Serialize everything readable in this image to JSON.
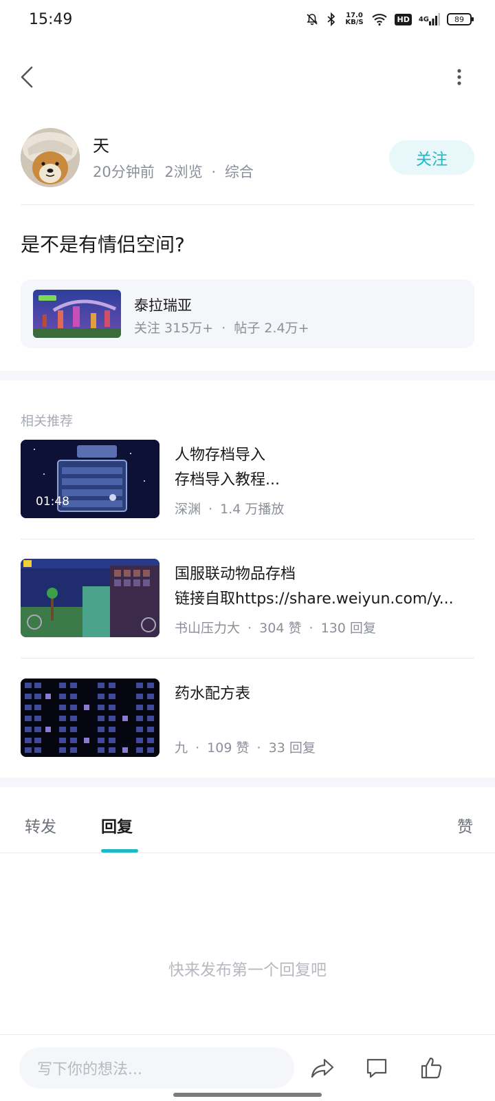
{
  "status_bar": {
    "time": "15:49",
    "net_speed_value": "17.0",
    "net_speed_unit": "KB/S",
    "hd_label": "HD",
    "signal_label": "4G",
    "battery": "89"
  },
  "author": {
    "name": "天",
    "time_ago": "20分钟前",
    "views": "2浏览",
    "separator": "·",
    "category": "综合",
    "follow_label": "关注"
  },
  "post": {
    "title": "是不是有情侣空间?"
  },
  "forum": {
    "name": "泰拉瑞亚",
    "followers": "关注 315万+",
    "separator": "·",
    "posts": "帖子 2.4万+"
  },
  "recommend": {
    "header": "相关推荐",
    "items": [
      {
        "title_line1": "人物存档导入",
        "title_line2": "存档导入教程...",
        "duration": "01:48",
        "author": "深渊",
        "stat1": "1.4 万播放",
        "stat2": ""
      },
      {
        "title_line1": "国服联动物品存档",
        "title_line2": "链接自取https://share.weiyun.com/y...",
        "duration": "",
        "author": "书山压力大",
        "stat1": "304 赞",
        "stat2": "130 回复"
      },
      {
        "title_line1": "药水配方表",
        "title_line2": "",
        "duration": "",
        "author": "九",
        "stat1": "109 赞",
        "stat2": "33 回复"
      }
    ]
  },
  "tabs": {
    "forward": "转发",
    "reply": "回复",
    "like": "赞"
  },
  "empty_state": "快来发布第一个回复吧",
  "bottom_bar": {
    "input_placeholder": "写下你的想法..."
  },
  "colors": {
    "accent": "#1fb8c8",
    "follow_bg": "#e7f7fa",
    "meta_text": "#8a8f99",
    "card_bg": "#f5f6fa"
  },
  "icons": [
    "mute-bell-icon",
    "bluetooth-icon",
    "wifi-icon",
    "signal-icon",
    "battery-icon",
    "back-arrow-icon",
    "more-vertical-icon",
    "share-icon",
    "comment-icon",
    "thumbs-up-icon"
  ]
}
